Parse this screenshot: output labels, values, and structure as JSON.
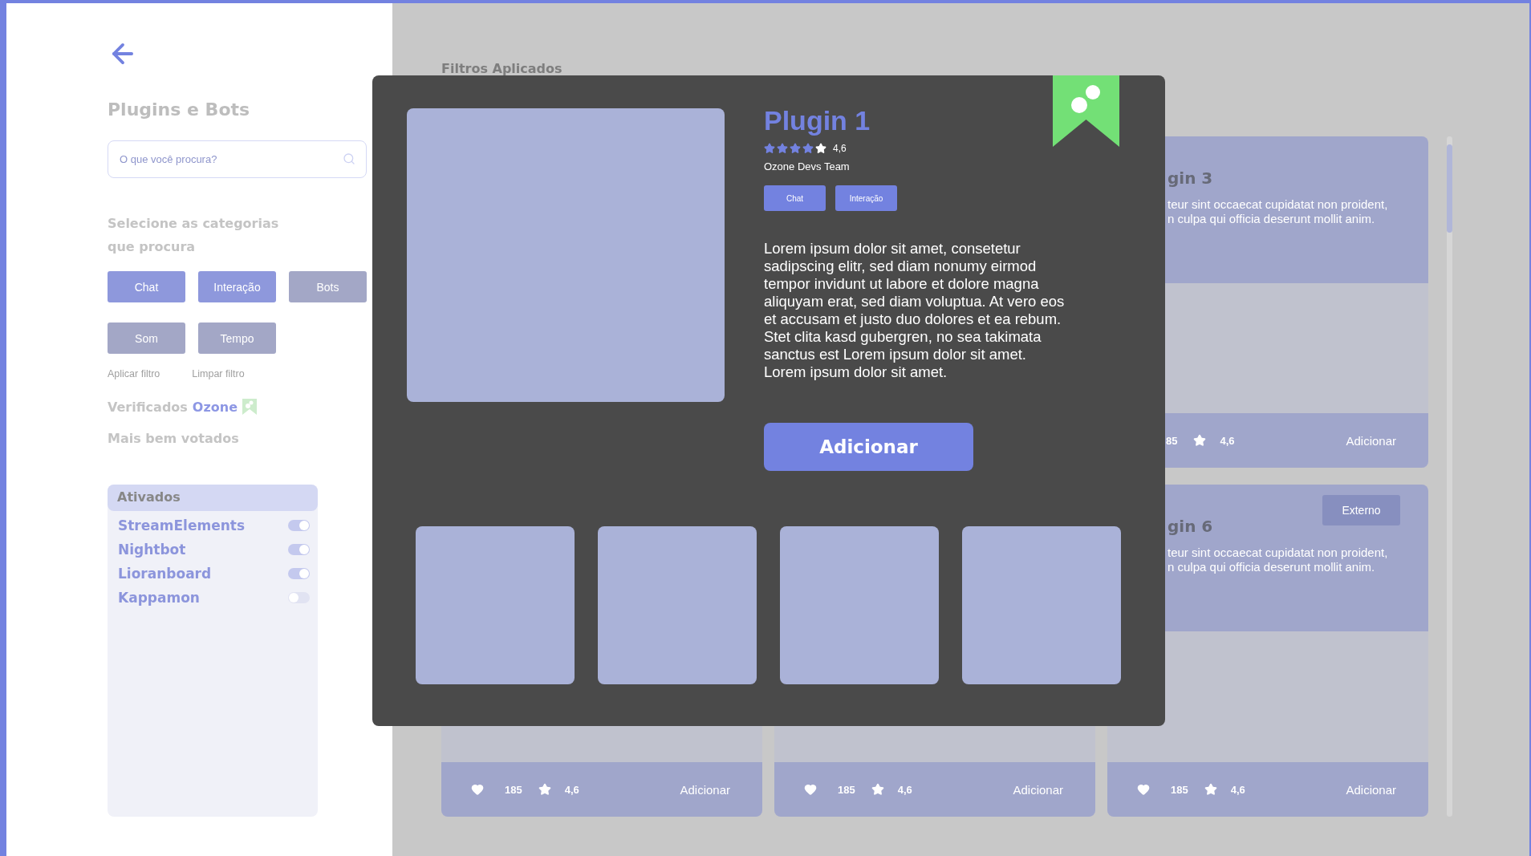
{
  "sidebar": {
    "title": "Plugins e Bots",
    "search": {
      "placeholder": "O que você procura?"
    },
    "categories_heading": "Selecione as categorias que procura",
    "categories": [
      {
        "label": "Chat",
        "selected": true
      },
      {
        "label": "Interação",
        "selected": true
      },
      {
        "label": "Bots",
        "selected": false
      },
      {
        "label": "Som",
        "selected": false
      },
      {
        "label": "Tempo",
        "selected": false
      }
    ],
    "actions": [
      "Aplicar filtro",
      "Limpar filtro"
    ],
    "verified": {
      "label": "Verificados",
      "brand": "Ozone"
    },
    "top_rated": "Mais bem votados",
    "active": {
      "title": "Ativados",
      "items": [
        {
          "name": "StreamElements",
          "on": true
        },
        {
          "name": "Nightbot",
          "on": true
        },
        {
          "name": "Lioranboard",
          "on": true
        },
        {
          "name": "Kappamon",
          "on": false
        }
      ]
    }
  },
  "main": {
    "heading": "Filtros Aplicados",
    "cards": [
      {
        "kind": "clipped",
        "title": "gin 3",
        "description_lines": [
          "teur sint occaecat cupidatat non proident,",
          "n culpa qui officia deserunt mollit anim."
        ],
        "footer": {
          "heart": false,
          "likes": "85",
          "rating": "4,6",
          "action": "Adicionar"
        }
      },
      {
        "kind": "covered",
        "footer": {
          "heart": true,
          "likes": "185",
          "rating": "4,6",
          "action": "Adicionar"
        }
      },
      {
        "kind": "covered",
        "footer": {
          "heart": true,
          "likes": "185",
          "rating": "4,6",
          "action": "Adicionar"
        }
      },
      {
        "kind": "clipped",
        "badge": "Externo",
        "title": "gin 6",
        "description_lines": [
          "teur sint occaecat cupidatat non proident,",
          "n culpa qui officia deserunt mollit anim."
        ],
        "footer": {
          "heart": true,
          "likes": "185",
          "rating": "4,6",
          "action": "Adicionar"
        }
      }
    ]
  },
  "modal": {
    "title": "Plugin 1",
    "stars": 4,
    "rating": "4,6",
    "author": "Ozone Devs Team",
    "tags": [
      "Chat",
      "Interação"
    ],
    "description": "Lorem ipsum dolor sit amet, consetetur sadipscing elitr, sed diam nonumy eirmod tempor invidunt ut labore et dolore magna aliquyam erat, sed diam voluptua. At vero eos et accusam et justo duo dolores et ea rebum. Stet clita kasd gubergren, no sea takimata sanctus est Lorem ipsum dolor sit amet. Lorem ipsum dolor sit amet.",
    "button": "Adicionar",
    "verified": true
  }
}
